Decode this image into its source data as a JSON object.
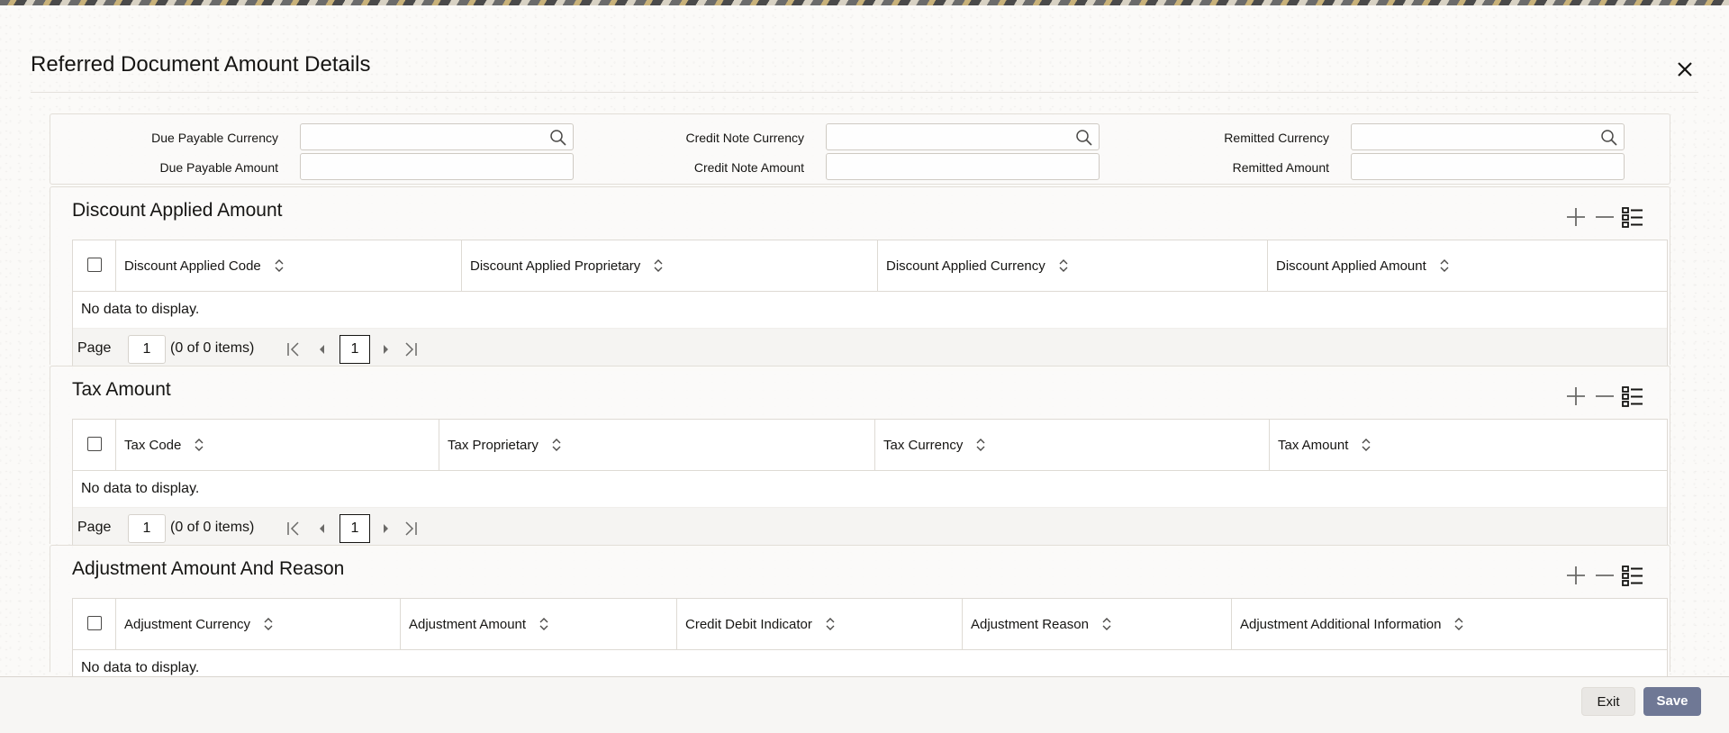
{
  "dialog": {
    "title": "Referred Document Amount Details",
    "close_icon": "close-icon"
  },
  "fields": {
    "due_payable_currency": {
      "label": "Due Payable Currency",
      "value": ""
    },
    "due_payable_amount": {
      "label": "Due Payable Amount",
      "value": ""
    },
    "credit_note_currency": {
      "label": "Credit Note Currency",
      "value": ""
    },
    "credit_note_amount": {
      "label": "Credit Note Amount",
      "value": ""
    },
    "remitted_currency": {
      "label": "Remitted Currency",
      "value": ""
    },
    "remitted_amount": {
      "label": "Remitted Amount",
      "value": ""
    }
  },
  "sections": [
    {
      "title": "Discount Applied Amount",
      "columns": [
        "Discount Applied Code",
        "Discount Applied Proprietary",
        "Discount Applied Currency",
        "Discount Applied Amount"
      ],
      "empty_text": "No data to display.",
      "pager": {
        "label": "Page",
        "page": "1",
        "count": "(0 of 0 items)",
        "current": "1"
      }
    },
    {
      "title": "Tax Amount",
      "columns": [
        "Tax Code",
        "Tax Proprietary",
        "Tax Currency",
        "Tax Amount"
      ],
      "empty_text": "No data to display.",
      "pager": {
        "label": "Page",
        "page": "1",
        "count": "(0 of 0 items)",
        "current": "1"
      }
    },
    {
      "title": "Adjustment Amount And Reason",
      "columns": [
        "Adjustment Currency",
        "Adjustment Amount",
        "Credit Debit Indicator",
        "Adjustment Reason",
        "Adjustment Additional Information"
      ],
      "empty_text": "No data to display."
    }
  ],
  "footer": {
    "exit_label": "Exit",
    "save_label": "Save"
  },
  "colors": {
    "save_button": "#6f7895",
    "text": "#161513",
    "border": "#dedad4"
  }
}
